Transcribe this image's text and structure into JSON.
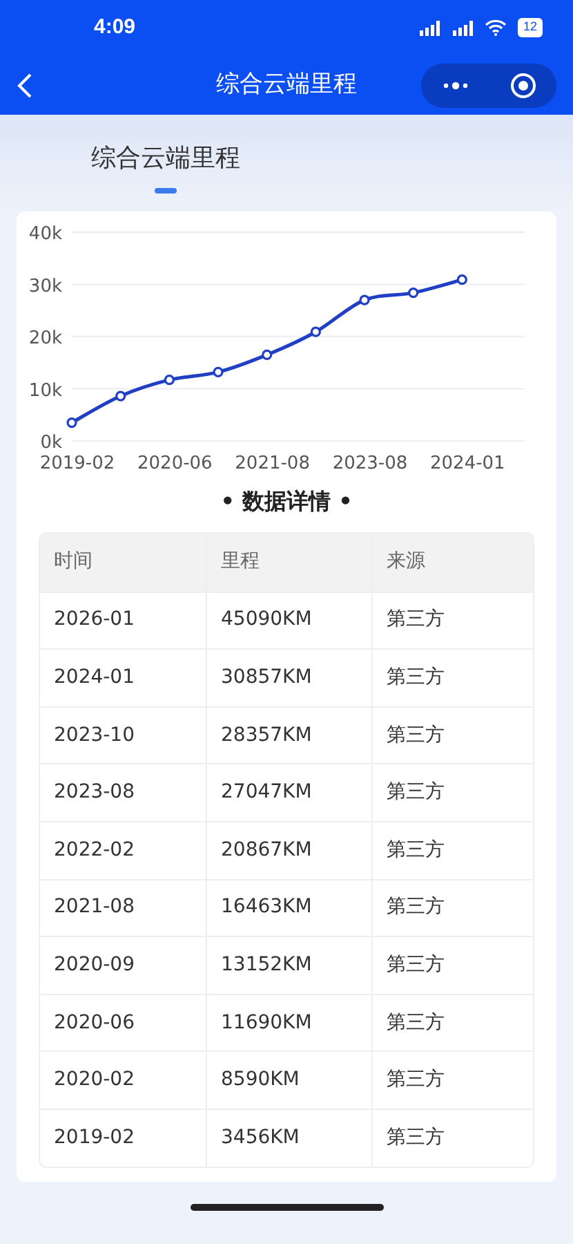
{
  "status_bar": {
    "time": "4:09",
    "battery": "12"
  },
  "nav": {
    "title": "综合云端里程"
  },
  "tabs": [
    {
      "label": "综合云端里程",
      "selected": true
    }
  ],
  "chart_data": {
    "type": "line",
    "grid": true,
    "categories": [
      "2019-02",
      null,
      "2020-06",
      null,
      "2021-08",
      null,
      "2023-08",
      null,
      "2024-01",
      null
    ],
    "series": [
      {
        "color": "#1f3fc4",
        "marker": "circle",
        "values": [
          3500,
          8600,
          11700,
          13200,
          16500,
          20900,
          27000,
          28400,
          30900,
          null
        ]
      }
    ],
    "ylim": [
      0,
      40000
    ],
    "yticks": [
      {
        "value": 0,
        "label": "0k"
      },
      {
        "value": 10000,
        "label": "10k"
      },
      {
        "value": 20000,
        "label": "20k"
      },
      {
        "value": 30000,
        "label": "30k"
      },
      {
        "value": 40000,
        "label": "40k"
      }
    ]
  },
  "section_title": "• 数据详情 •",
  "table": {
    "columns": [
      "时间",
      "里程",
      "来源"
    ],
    "rows": [
      [
        "2026-01",
        "45090KM",
        "第三方"
      ],
      [
        "2024-01",
        "30857KM",
        "第三方"
      ],
      [
        "2023-10",
        "28357KM",
        "第三方"
      ],
      [
        "2023-08",
        "27047KM",
        "第三方"
      ],
      [
        "2022-02",
        "20867KM",
        "第三方"
      ],
      [
        "2021-08",
        "16463KM",
        "第三方"
      ],
      [
        "2020-09",
        "13152KM",
        "第三方"
      ],
      [
        "2020-06",
        "11690KM",
        "第三方"
      ],
      [
        "2020-02",
        "8590KM",
        "第三方"
      ],
      [
        "2019-02",
        "3456KM",
        "第三方"
      ]
    ]
  }
}
